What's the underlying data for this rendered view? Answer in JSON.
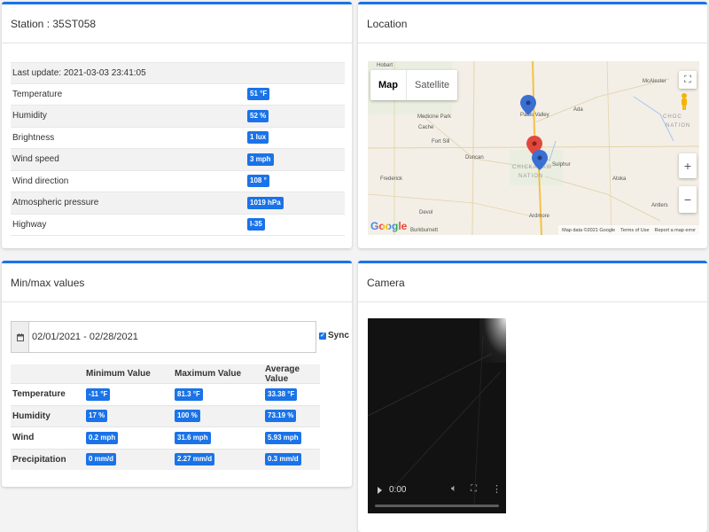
{
  "station": {
    "title": "Station : 35ST058",
    "last_update": "Last update: 2021-03-03 23:41:05",
    "rows": [
      {
        "label": "Temperature",
        "value": "51 °F"
      },
      {
        "label": "Humidity",
        "value": "52 %"
      },
      {
        "label": "Brightness",
        "value": "1 lux"
      },
      {
        "label": "Wind speed",
        "value": "3 mph"
      },
      {
        "label": "Wind direction",
        "value": "108 °"
      },
      {
        "label": "Atmospheric pressure",
        "value": "1019 hPa"
      },
      {
        "label": "Highway",
        "value": "I-35"
      }
    ]
  },
  "location": {
    "title": "Location",
    "map_type": {
      "map": "Map",
      "satellite": "Satellite"
    },
    "zoom_in": "+",
    "zoom_out": "−",
    "attribution": {
      "data": "Map data ©2021 Google",
      "terms": "Terms of Use",
      "report": "Report a map error"
    },
    "google_logo": "Google",
    "places": {
      "hobart": "Hobart",
      "medicine_park": "Medicine Park",
      "cache": "Cache",
      "fort_sill": "Fort Sill",
      "duncan": "Duncan",
      "frederick": "Frederick",
      "devol": "Devol",
      "burkburnett": "Burkburnett",
      "pauls_valley": "Pauls Valley",
      "ada": "Ada",
      "mcalester": "McAlester",
      "choctaw": "CHOC",
      "nation": "NATION",
      "chickasaw": "CHICKASAW",
      "chickasaw_nation": "NATION",
      "sulphur": "Sulphur",
      "ardmore": "Ardmore",
      "atoka": "Atoka",
      "antlers": "Antlers"
    }
  },
  "minmax": {
    "title": "Min/max values",
    "date_range": "02/01/2021 - 02/28/2021",
    "sync_label": "Sync",
    "headers": [
      "",
      "Minimum Value",
      "Maximum Value",
      "Average Value"
    ],
    "rows": [
      {
        "label": "Temperature",
        "min": "-11 °F",
        "max": "81.3 °F",
        "avg": "33.38 °F"
      },
      {
        "label": "Humidity",
        "min": "17 %",
        "max": "100 %",
        "avg": "73.19 %"
      },
      {
        "label": "Wind",
        "min": "0.2 mph",
        "max": "31.6 mph",
        "avg": "5.93 mph"
      },
      {
        "label": "Precipitation",
        "min": "0 mm/d",
        "max": "2.27 mm/d",
        "avg": "0.3 mm/d"
      }
    ]
  },
  "camera": {
    "title": "Camera",
    "video_time": "0:00"
  },
  "colors": {
    "accent": "#1a73e8",
    "marker_blue": "#3b6fd1",
    "marker_red": "#e0483e"
  },
  "icons": {
    "calendar": "calendar-icon",
    "fullscreen": "fullscreen-icon",
    "pegman": "pegman-icon",
    "play": "play-icon",
    "volume": "volume-icon",
    "more": "more-icon"
  }
}
